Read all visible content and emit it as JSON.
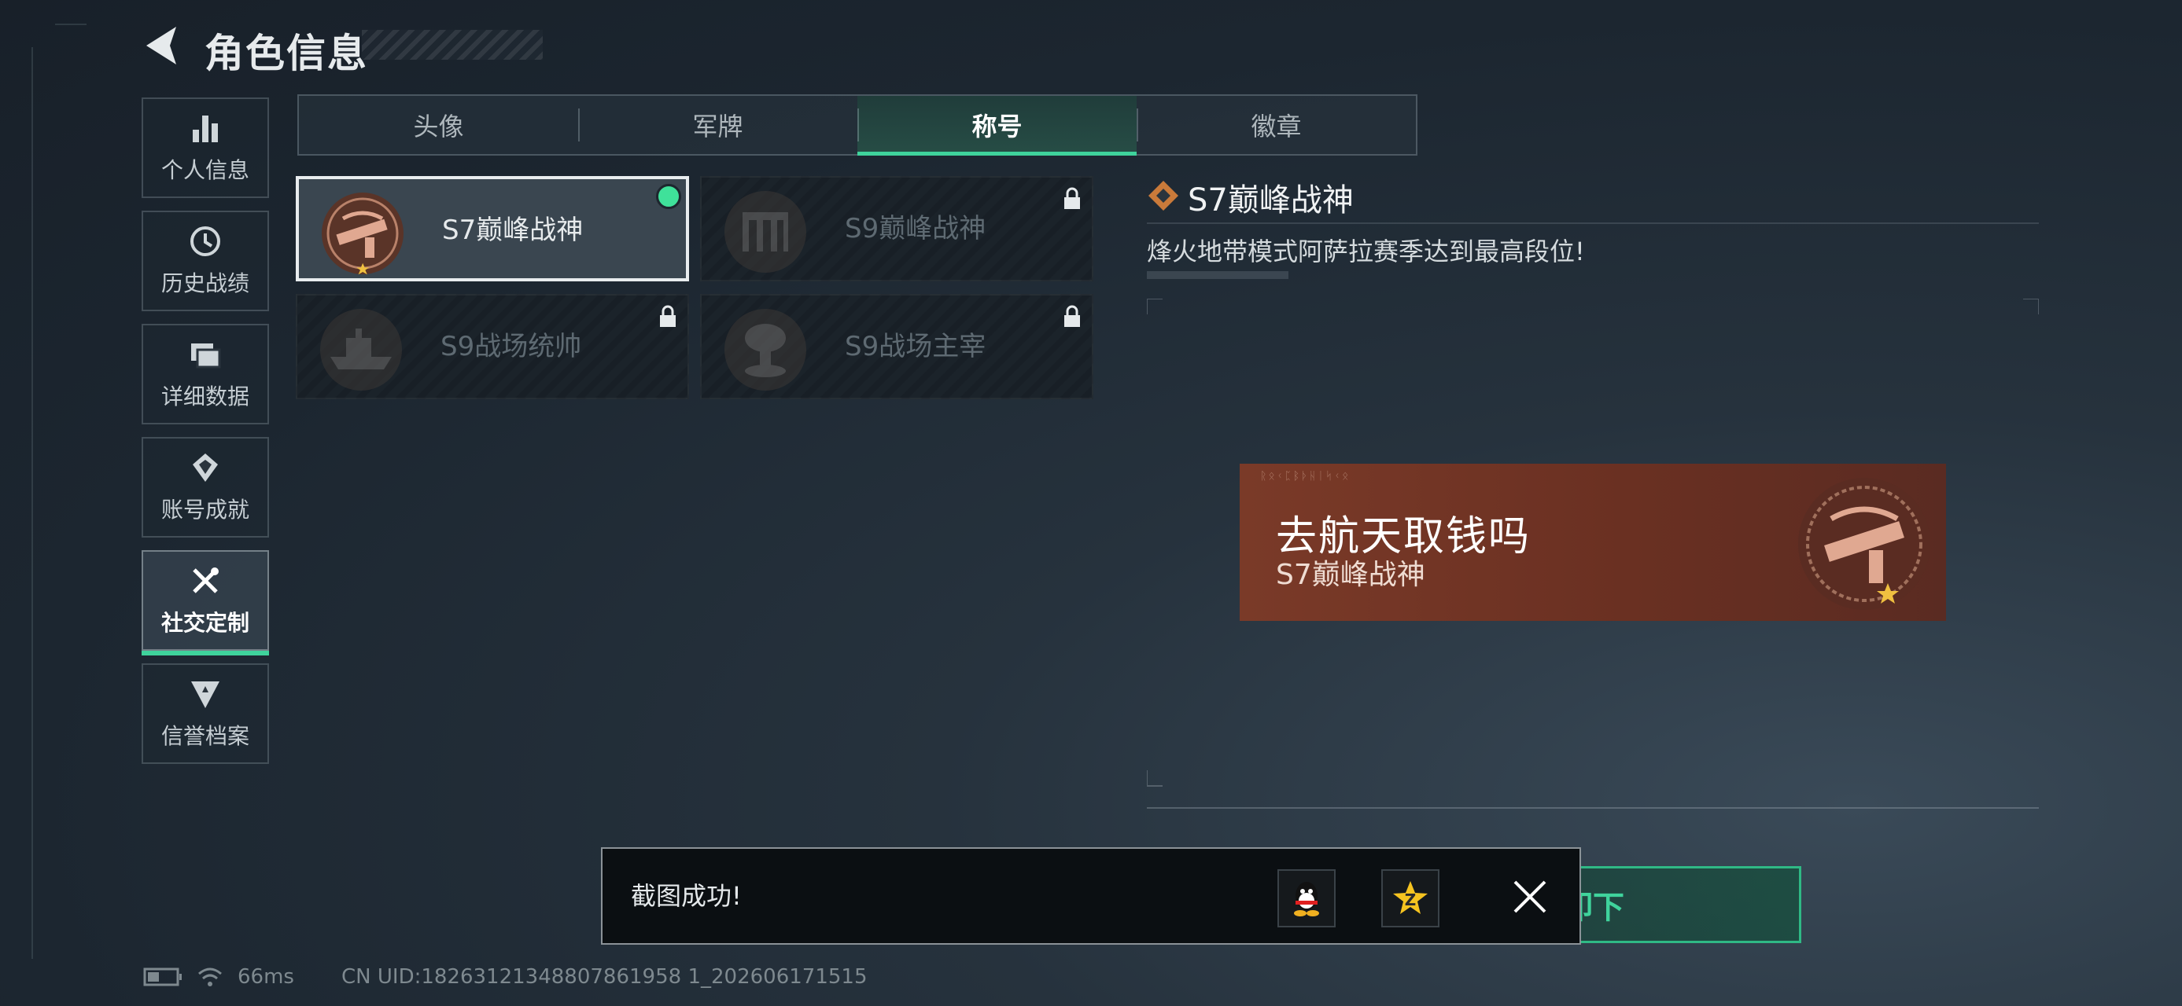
{
  "header": {
    "title": "角色信息"
  },
  "sidebar": {
    "items": [
      {
        "label": "个人信息",
        "icon": "bar-chart-icon"
      },
      {
        "label": "历史战绩",
        "icon": "history-clock-icon"
      },
      {
        "label": "详细数据",
        "icon": "folder-icon"
      },
      {
        "label": "账号成就",
        "icon": "achievement-icon"
      },
      {
        "label": "社交定制",
        "icon": "tools-icon",
        "active": true
      },
      {
        "label": "信誉档案",
        "icon": "credit-shield-icon"
      }
    ]
  },
  "tabs": [
    {
      "label": "头像"
    },
    {
      "label": "军牌"
    },
    {
      "label": "称号",
      "active": true
    },
    {
      "label": "徽章"
    }
  ],
  "titles": [
    {
      "name": "S7巅峰战神",
      "locked": false,
      "equipped": true
    },
    {
      "name": "S9巅峰战神",
      "locked": true
    },
    {
      "name": "S9战场统帅",
      "locked": true
    },
    {
      "name": "S9战场主宰",
      "locked": true
    }
  ],
  "detail": {
    "title": "S7巅峰战神",
    "description": "烽火地带模式阿萨拉赛季达到最高段位!"
  },
  "banner": {
    "player_name": "去航天取钱吗",
    "title": "S7巅峰战神",
    "deco_text": "ᚱᛟᚲᛈᛒᚦᚺᛁᛋᚲᛟ"
  },
  "unequip_button": {
    "label": "卸下"
  },
  "toast": {
    "message": "截图成功!",
    "share_targets": [
      "qq-icon",
      "qzone-icon"
    ]
  },
  "status_bar": {
    "ping": "66ms",
    "uid": "CN UID:18263121348807861958 1_202606171515"
  },
  "colors": {
    "accent": "#3fd39c",
    "banner": "#6a3022",
    "equipped_dot": "#3fe19a"
  }
}
